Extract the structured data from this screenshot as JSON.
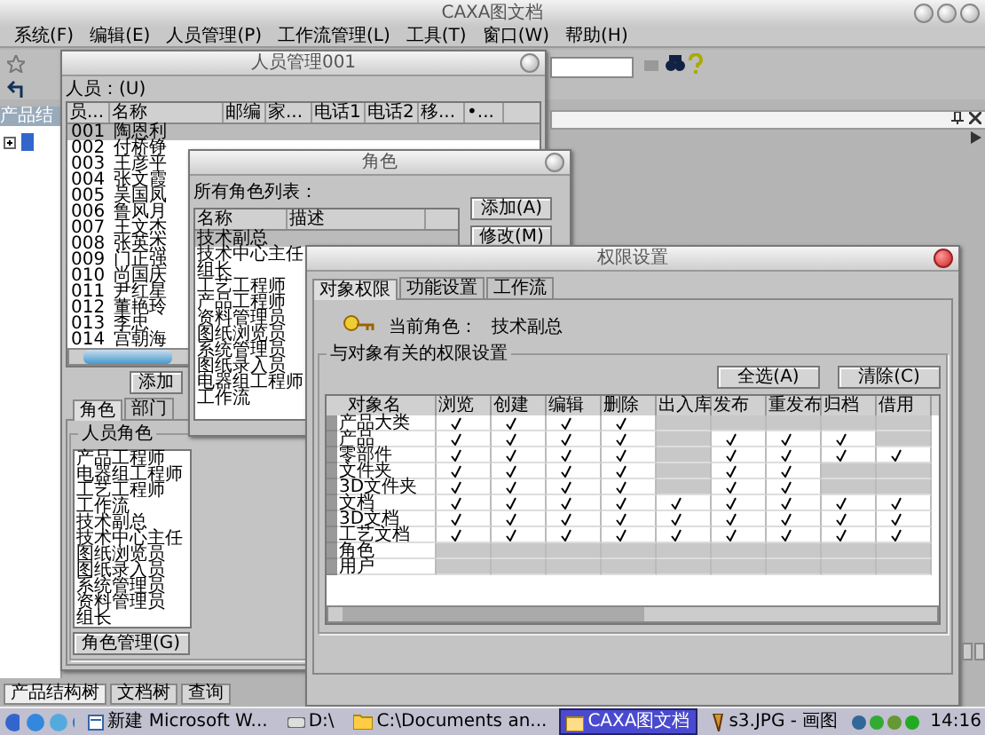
{
  "app": {
    "title": "CAXA图文档",
    "menu": [
      "系统(F)",
      "编辑(E)",
      "人员管理(P)",
      "工作流管理(L)",
      "工具(T)",
      "窗口(W)",
      "帮助(H)"
    ],
    "tree_header": "产品结",
    "bottom_tabs": [
      {
        "label": "产品结构树",
        "selected": true
      },
      {
        "label": "文档树",
        "selected": false
      },
      {
        "label": "查询",
        "selected": false
      }
    ]
  },
  "people_window": {
    "title": "人员管理001",
    "list_label": "人员：(U)",
    "columns": [
      "员...",
      "名称",
      "邮编",
      "家...",
      "电话1",
      "电话2",
      "移...",
      "•..."
    ],
    "rows": [
      {
        "id": "001",
        "name": "陶恩利",
        "selected": true
      },
      {
        "id": "002",
        "name": "付桥铮",
        "selected": false
      },
      {
        "id": "003",
        "name": "王彦平",
        "selected": false
      },
      {
        "id": "004",
        "name": "张文霞",
        "selected": false
      },
      {
        "id": "005",
        "name": "吴国凤",
        "selected": false
      },
      {
        "id": "006",
        "name": "鲁风月",
        "selected": false
      },
      {
        "id": "007",
        "name": "王文杰",
        "selected": false
      },
      {
        "id": "008",
        "name": "张英杰",
        "selected": false
      },
      {
        "id": "009",
        "name": "门正强",
        "selected": false
      },
      {
        "id": "010",
        "name": "尚国庆",
        "selected": false
      },
      {
        "id": "011",
        "name": "尹红星",
        "selected": false
      },
      {
        "id": "012",
        "name": "董艳玲",
        "selected": false
      },
      {
        "id": "013",
        "name": "李忠",
        "selected": false
      },
      {
        "id": "014",
        "name": "宫朝海",
        "selected": false
      }
    ],
    "add_button": "添加",
    "tabs": [
      {
        "label": "角色",
        "selected": true
      },
      {
        "label": "部门",
        "selected": false
      }
    ],
    "group_label": "人员角色",
    "roles": [
      "产品工程师",
      "电器组工程师",
      "工艺工程师",
      "工作流",
      "技术副总",
      "技术中心主任",
      "图纸浏览员",
      "图纸录入员",
      "系统管理员",
      "资料管理员",
      "组长"
    ],
    "manage_button": "角色管理(G)"
  },
  "role_window": {
    "title": "角色",
    "list_label": "所有角色列表：",
    "columns": [
      "名称",
      "描述"
    ],
    "roles": [
      {
        "name": "技术副总",
        "selected": true
      },
      {
        "name": "技术中心主任",
        "selected": false
      },
      {
        "name": "组长",
        "selected": false
      },
      {
        "name": "工艺工程师",
        "selected": false
      },
      {
        "name": "产品工程师",
        "selected": false
      },
      {
        "name": "资料管理员",
        "selected": false
      },
      {
        "name": "图纸浏览员",
        "selected": false
      },
      {
        "name": "系统管理员",
        "selected": false
      },
      {
        "name": "图纸录入员",
        "selected": false
      },
      {
        "name": "电器组工程师",
        "selected": false
      },
      {
        "name": "工作流",
        "selected": false
      }
    ],
    "buttons": [
      "添加(A)",
      "修改(M)"
    ]
  },
  "permission_window": {
    "title": "权限设置",
    "tabs": [
      {
        "label": "对象权限",
        "selected": true
      },
      {
        "label": "功能设置",
        "selected": false
      },
      {
        "label": "工作流",
        "selected": false
      }
    ],
    "current_role_label": "当前角色：",
    "current_role": "技术副总",
    "group_label": "与对象有关的权限设置",
    "buttons": [
      "全选(A)",
      "清除(C)"
    ],
    "columns": [
      "对象名",
      "浏览",
      "创建",
      "编辑",
      "删除",
      "出入库",
      "发布",
      "重发布",
      "归档",
      "借用"
    ],
    "rows": [
      {
        "name": "产品大类",
        "cells": [
          {
            "checked": true,
            "disabled": false
          },
          {
            "checked": true,
            "disabled": false
          },
          {
            "checked": true,
            "disabled": false
          },
          {
            "checked": true,
            "disabled": false
          },
          {
            "checked": false,
            "disabled": true
          },
          {
            "checked": false,
            "disabled": true
          },
          {
            "checked": false,
            "disabled": true
          },
          {
            "checked": false,
            "disabled": true
          },
          {
            "checked": false,
            "disabled": true
          }
        ]
      },
      {
        "name": "产品",
        "cells": [
          {
            "checked": true,
            "disabled": false
          },
          {
            "checked": true,
            "disabled": false
          },
          {
            "checked": true,
            "disabled": false
          },
          {
            "checked": true,
            "disabled": false
          },
          {
            "checked": false,
            "disabled": true
          },
          {
            "checked": true,
            "disabled": false
          },
          {
            "checked": true,
            "disabled": false
          },
          {
            "checked": true,
            "disabled": false
          },
          {
            "checked": false,
            "disabled": true
          }
        ]
      },
      {
        "name": "零部件",
        "cells": [
          {
            "checked": true,
            "disabled": false
          },
          {
            "checked": true,
            "disabled": false
          },
          {
            "checked": true,
            "disabled": false
          },
          {
            "checked": true,
            "disabled": false
          },
          {
            "checked": false,
            "disabled": true
          },
          {
            "checked": true,
            "disabled": false
          },
          {
            "checked": true,
            "disabled": false
          },
          {
            "checked": true,
            "disabled": false
          },
          {
            "checked": true,
            "disabled": false
          }
        ]
      },
      {
        "name": "文件夹",
        "cells": [
          {
            "checked": true,
            "disabled": false
          },
          {
            "checked": true,
            "disabled": false
          },
          {
            "checked": true,
            "disabled": false
          },
          {
            "checked": true,
            "disabled": false
          },
          {
            "checked": false,
            "disabled": true
          },
          {
            "checked": true,
            "disabled": false
          },
          {
            "checked": true,
            "disabled": false
          },
          {
            "checked": false,
            "disabled": true
          },
          {
            "checked": false,
            "disabled": true
          }
        ]
      },
      {
        "name": "3D文件夹",
        "cells": [
          {
            "checked": true,
            "disabled": false
          },
          {
            "checked": true,
            "disabled": false
          },
          {
            "checked": true,
            "disabled": false
          },
          {
            "checked": true,
            "disabled": false
          },
          {
            "checked": false,
            "disabled": true
          },
          {
            "checked": true,
            "disabled": false
          },
          {
            "checked": true,
            "disabled": false
          },
          {
            "checked": false,
            "disabled": true
          },
          {
            "checked": false,
            "disabled": true
          }
        ]
      },
      {
        "name": "文档",
        "cells": [
          {
            "checked": true,
            "disabled": false
          },
          {
            "checked": true,
            "disabled": false
          },
          {
            "checked": true,
            "disabled": false
          },
          {
            "checked": true,
            "disabled": false
          },
          {
            "checked": true,
            "disabled": false
          },
          {
            "checked": true,
            "disabled": false
          },
          {
            "checked": true,
            "disabled": false
          },
          {
            "checked": true,
            "disabled": false
          },
          {
            "checked": true,
            "disabled": false
          }
        ]
      },
      {
        "name": "3D文档",
        "cells": [
          {
            "checked": true,
            "disabled": false
          },
          {
            "checked": true,
            "disabled": false
          },
          {
            "checked": true,
            "disabled": false
          },
          {
            "checked": true,
            "disabled": false
          },
          {
            "checked": true,
            "disabled": false
          },
          {
            "checked": true,
            "disabled": false
          },
          {
            "checked": true,
            "disabled": false
          },
          {
            "checked": true,
            "disabled": false
          },
          {
            "checked": true,
            "disabled": false
          }
        ]
      },
      {
        "name": "工艺文档",
        "cells": [
          {
            "checked": true,
            "disabled": false
          },
          {
            "checked": true,
            "disabled": false
          },
          {
            "checked": true,
            "disabled": false
          },
          {
            "checked": true,
            "disabled": false
          },
          {
            "checked": true,
            "disabled": false
          },
          {
            "checked": true,
            "disabled": false
          },
          {
            "checked": true,
            "disabled": false
          },
          {
            "checked": true,
            "disabled": false
          },
          {
            "checked": true,
            "disabled": false
          }
        ]
      },
      {
        "name": "角色",
        "cells": [
          {
            "checked": false,
            "disabled": true
          },
          {
            "checked": false,
            "disabled": true
          },
          {
            "checked": false,
            "disabled": true
          },
          {
            "checked": false,
            "disabled": true
          },
          {
            "checked": false,
            "disabled": true
          },
          {
            "checked": false,
            "disabled": true
          },
          {
            "checked": false,
            "disabled": true
          },
          {
            "checked": false,
            "disabled": true
          },
          {
            "checked": false,
            "disabled": true
          }
        ]
      },
      {
        "name": "用户",
        "cells": [
          {
            "checked": false,
            "disabled": true
          },
          {
            "checked": false,
            "disabled": true
          },
          {
            "checked": false,
            "disabled": true
          },
          {
            "checked": false,
            "disabled": true
          },
          {
            "checked": false,
            "disabled": true
          },
          {
            "checked": false,
            "disabled": true
          },
          {
            "checked": false,
            "disabled": true
          },
          {
            "checked": false,
            "disabled": true
          },
          {
            "checked": false,
            "disabled": true
          }
        ]
      }
    ]
  },
  "taskbar": {
    "items": [
      {
        "label": "新建 Microsoft W...",
        "kind": "document",
        "selected": false
      },
      {
        "label": "D:\\",
        "kind": "drive",
        "selected": false
      },
      {
        "label": "C:\\Documents an...",
        "kind": "folder",
        "selected": false
      },
      {
        "label": "CAXA图文档",
        "kind": "app",
        "selected": true
      },
      {
        "label": "s3.JPG - 画图",
        "kind": "paint",
        "selected": false
      }
    ],
    "clock": "14:16"
  }
}
